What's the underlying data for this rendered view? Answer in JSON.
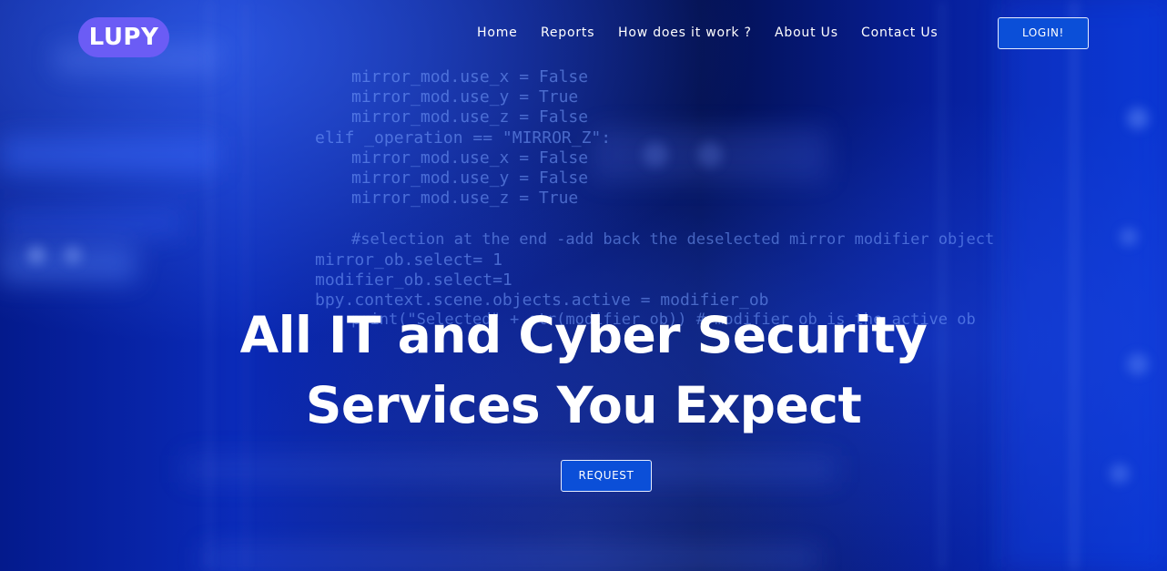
{
  "brand": {
    "logo_text": "LUPY",
    "logo_color": "#6b5cf5"
  },
  "nav": {
    "items": [
      {
        "label": "Home"
      },
      {
        "label": "Reports"
      },
      {
        "label": "How does it work ?"
      },
      {
        "label": "About Us"
      },
      {
        "label": "Contact Us"
      }
    ],
    "login_label": "LOGIN!"
  },
  "hero": {
    "headline_line1": "All IT and Cyber Security",
    "headline_line2": "Services You Expect",
    "cta_label": "REQUEST",
    "button_color": "#0b4fd8",
    "background_color": "#0a2ab8",
    "background_code": [
      "mirror_mod.use_x = False",
      "mirror_mod.use_y = True",
      "mirror_mod.use_z = False",
      "elif _operation == \"MIRROR_Z\":",
      "mirror_mod.use_x = False",
      "mirror_mod.use_y = False",
      "mirror_mod.use_z = True",
      "#selection at the end -add back the deselected mirror modifier object",
      "mirror_ob.select= 1",
      "modifier_ob.select=1",
      "bpy.context.scene.objects.active = modifier_ob",
      "print(\"Selected\" + str(modifier_ob)) # modifier ob is the active ob"
    ]
  }
}
